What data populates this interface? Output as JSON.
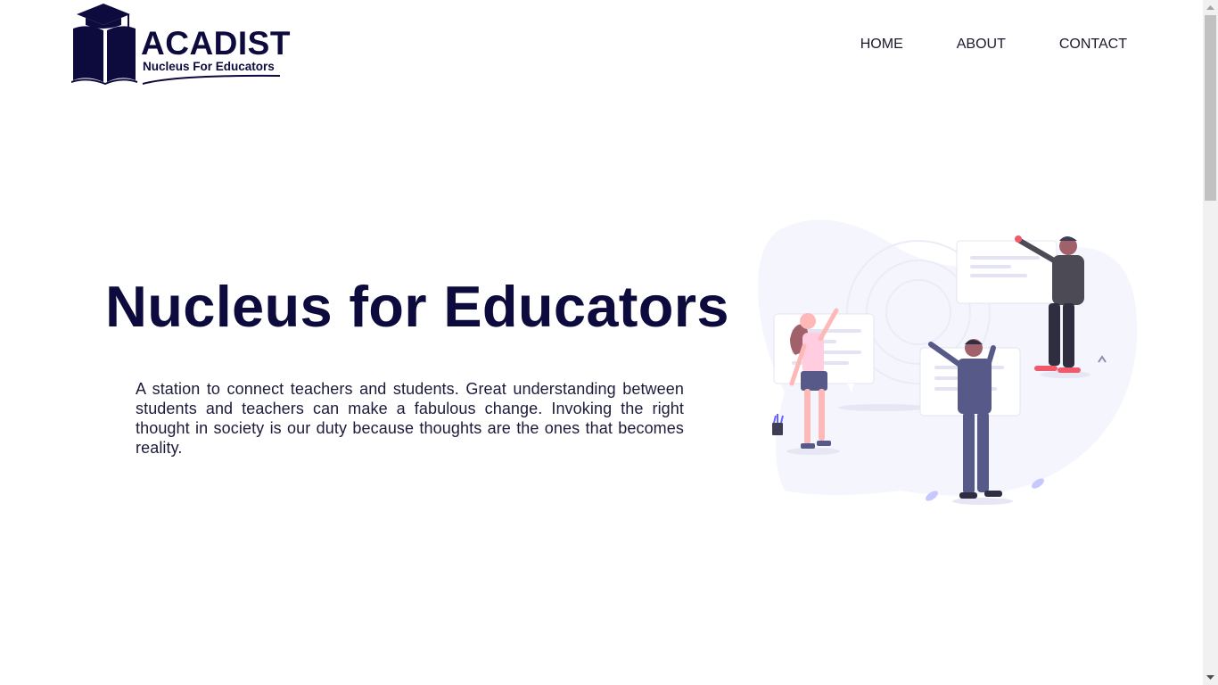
{
  "brand": {
    "name": "ACADIST",
    "tagline": "Nucleus For Educators",
    "color": "#0d0b3d"
  },
  "nav": {
    "items": [
      {
        "label": "HOME"
      },
      {
        "label": "ABOUT"
      },
      {
        "label": "CONTACT"
      }
    ]
  },
  "hero": {
    "title": "Nucleus for Educators",
    "description": "A station to connect teachers and students. Great understanding between students and teachers can make a fabulous change. Invoking the right thought in society is our duty because thoughts are the ones that becomes reality."
  },
  "illustration": {
    "icon": "people-collaborating-illustration",
    "colors": {
      "blob": "#f5f5fd",
      "accent": "#4b4a7a",
      "pink": "#ffb8d0",
      "red": "#f05a6b"
    }
  }
}
